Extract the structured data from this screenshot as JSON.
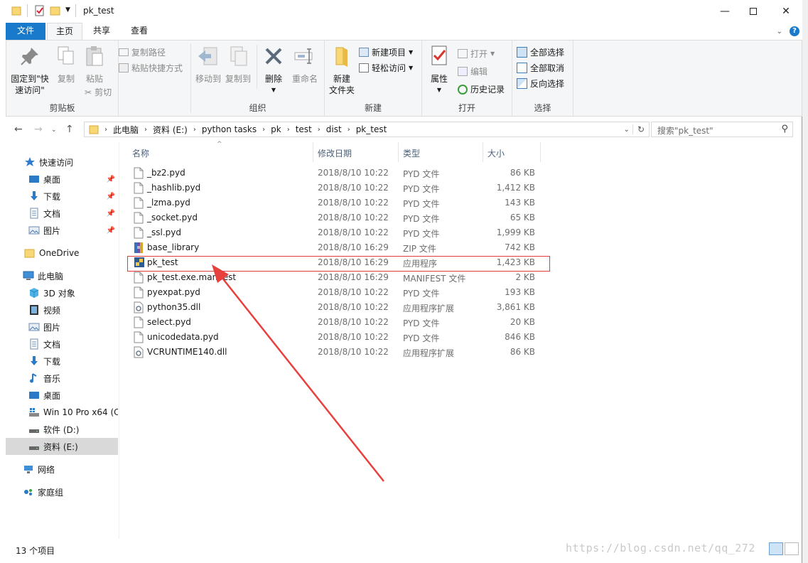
{
  "window": {
    "title": "pk_test"
  },
  "tabs": [
    {
      "label": "文件"
    },
    {
      "label": "主页"
    },
    {
      "label": "共享"
    },
    {
      "label": "查看"
    }
  ],
  "ribbon": {
    "clipboard": {
      "label": "剪贴板",
      "pin": "固定到\"快\n速访问\"",
      "pin_l1": "固定到\"快",
      "pin_l2": "速访问\"",
      "copy": "复制",
      "paste": "粘贴",
      "copy_path": "复制路径",
      "paste_shortcut": "粘贴快捷方式",
      "cut": "剪切"
    },
    "organize": {
      "label": "组织",
      "move_to": "移动到",
      "copy_to": "复制到",
      "delete": "删除",
      "rename": "重命名"
    },
    "new": {
      "label": "新建",
      "new_folder_l1": "新建",
      "new_folder_l2": "文件夹",
      "new_item": "新建项目",
      "easy_access": "轻松访问"
    },
    "open": {
      "label": "打开",
      "properties": "属性",
      "open": "打开",
      "edit": "编辑",
      "history": "历史记录"
    },
    "select": {
      "label": "选择",
      "select_all": "全部选择",
      "select_none": "全部取消",
      "invert": "反向选择"
    }
  },
  "address": {
    "crumbs": [
      "此电脑",
      "资料 (E:)",
      "python tasks",
      "pk",
      "test",
      "dist",
      "pk_test"
    ],
    "search_placeholder": "搜索\"pk_test\""
  },
  "nav": {
    "quick_access": "快速访问",
    "qa_items": [
      "桌面",
      "下载",
      "文档",
      "图片"
    ],
    "onedrive": "OneDrive",
    "this_pc": "此电脑",
    "pc_items": [
      "3D 对象",
      "视频",
      "图片",
      "文档",
      "下载",
      "音乐",
      "桌面",
      "Win 10 Pro x64 (C",
      "软件 (D:)",
      "资料 (E:)"
    ],
    "network": "网络",
    "homegroup": "家庭组"
  },
  "columns": {
    "name": "名称",
    "date": "修改日期",
    "type": "类型",
    "size": "大小"
  },
  "files": [
    {
      "name": "_bz2.pyd",
      "date": "2018/8/10 10:22",
      "type": "PYD 文件",
      "size": "86 KB",
      "icon": "file-icon"
    },
    {
      "name": "_hashlib.pyd",
      "date": "2018/8/10 10:22",
      "type": "PYD 文件",
      "size": "1,412 KB",
      "icon": "file-icon"
    },
    {
      "name": "_lzma.pyd",
      "date": "2018/8/10 10:22",
      "type": "PYD 文件",
      "size": "143 KB",
      "icon": "file-icon"
    },
    {
      "name": "_socket.pyd",
      "date": "2018/8/10 10:22",
      "type": "PYD 文件",
      "size": "65 KB",
      "icon": "file-icon"
    },
    {
      "name": "_ssl.pyd",
      "date": "2018/8/10 10:22",
      "type": "PYD 文件",
      "size": "1,999 KB",
      "icon": "file-icon"
    },
    {
      "name": "base_library",
      "date": "2018/8/10 16:29",
      "type": "ZIP 文件",
      "size": "742 KB",
      "icon": "zip-icon"
    },
    {
      "name": "pk_test",
      "date": "2018/8/10 16:29",
      "type": "应用程序",
      "size": "1,423 KB",
      "icon": "exe-icon"
    },
    {
      "name": "pk_test.exe.manifest",
      "date": "2018/8/10 16:29",
      "type": "MANIFEST 文件",
      "size": "2 KB",
      "icon": "file-icon"
    },
    {
      "name": "pyexpat.pyd",
      "date": "2018/8/10 10:22",
      "type": "PYD 文件",
      "size": "193 KB",
      "icon": "file-icon"
    },
    {
      "name": "python35.dll",
      "date": "2018/8/10 10:22",
      "type": "应用程序扩展",
      "size": "3,861 KB",
      "icon": "dll-icon"
    },
    {
      "name": "select.pyd",
      "date": "2018/8/10 10:22",
      "type": "PYD 文件",
      "size": "20 KB",
      "icon": "file-icon"
    },
    {
      "name": "unicodedata.pyd",
      "date": "2018/8/10 10:22",
      "type": "PYD 文件",
      "size": "846 KB",
      "icon": "file-icon"
    },
    {
      "name": "VCRUNTIME140.dll",
      "date": "2018/8/10 10:22",
      "type": "应用程序扩展",
      "size": "86 KB",
      "icon": "dll-icon"
    }
  ],
  "status": {
    "count": "13 个项目"
  },
  "watermark": "https://blog.csdn.net/qq_272",
  "colors": {
    "accent": "#1979ca",
    "highlight": "#e03c3c",
    "folder": "#f8d775"
  }
}
